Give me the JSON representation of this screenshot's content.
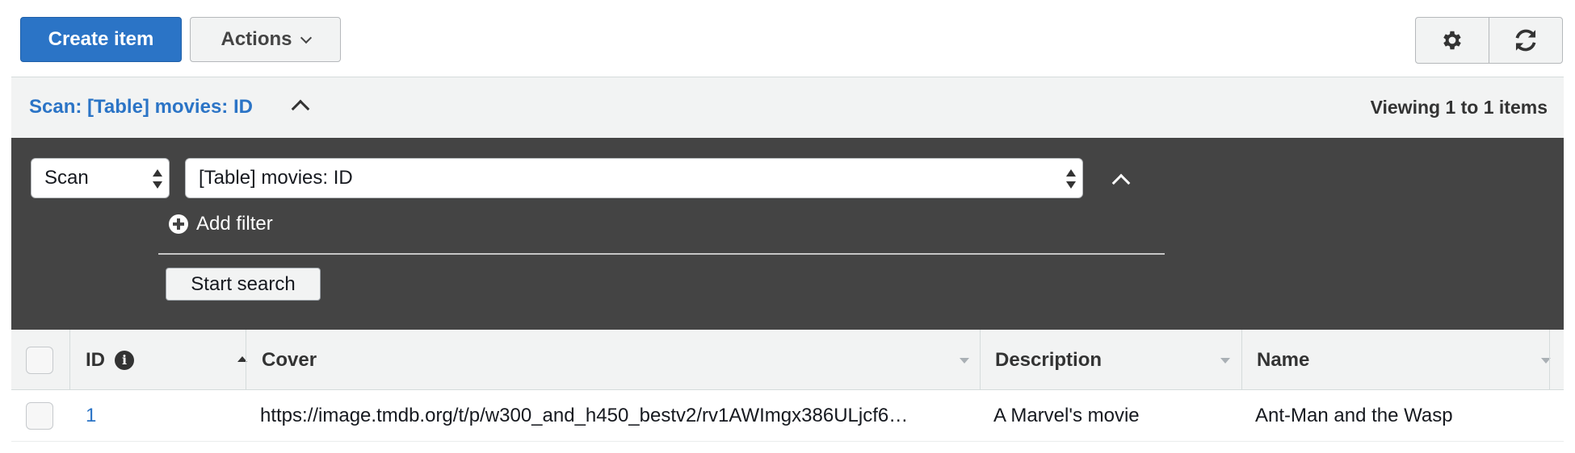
{
  "toolbar": {
    "create_label": "Create item",
    "actions_label": "Actions",
    "settings_icon": "gear-icon",
    "refresh_icon": "refresh-icon"
  },
  "scan_bar": {
    "title": "Scan: [Table] movies: ID",
    "viewing": "Viewing 1 to 1 items"
  },
  "filter": {
    "mode_value": "Scan",
    "table_value": "[Table] movies: ID",
    "add_filter_label": "Add filter",
    "start_search_label": "Start search"
  },
  "table": {
    "columns": [
      "ID",
      "Cover",
      "Description",
      "Name"
    ],
    "rows": [
      {
        "id": "1",
        "cover": "https://image.tmdb.org/t/p/w300_and_h450_bestv2/rv1AWImgx386ULjcf6…",
        "description": "A Marvel's movie",
        "name": "Ant-Man and the Wasp"
      }
    ]
  },
  "colors": {
    "primary": "#2b74c6",
    "panel": "#444444",
    "header_bg": "#f2f3f3"
  }
}
